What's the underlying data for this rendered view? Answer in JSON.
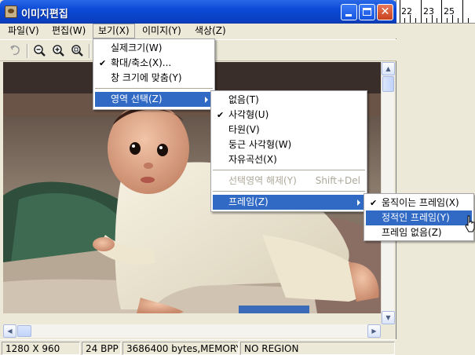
{
  "window": {
    "title": "이미지편집",
    "minimize_icon": "minimize-icon",
    "maximize_icon": "maximize-icon",
    "close_icon": "close-icon"
  },
  "menubar": [
    {
      "label": "파일(V)"
    },
    {
      "label": "편집(W)"
    },
    {
      "label": "보기(X)"
    },
    {
      "label": "이미지(Y)"
    },
    {
      "label": "색상(Z)"
    }
  ],
  "toolbar": {
    "icons": [
      "undo-icon",
      "zoom-out-icon",
      "zoom-in-icon",
      "zoom-fit-icon"
    ]
  },
  "view_menu": {
    "items": [
      {
        "label": "실제크기(W)",
        "checked": false
      },
      {
        "label": "확대/축소(X)...",
        "checked": true
      },
      {
        "label": "창 크기에 맞춤(Y)",
        "checked": false
      },
      {
        "label": "영역 선택(Z)",
        "submenu": true,
        "highlighted": true
      }
    ]
  },
  "region_menu": {
    "items": [
      {
        "label": "없음(T)",
        "checked": false
      },
      {
        "label": "사각형(U)",
        "checked": true
      },
      {
        "label": "타원(V)",
        "checked": false
      },
      {
        "label": "둥근 사각형(W)",
        "checked": false
      },
      {
        "label": "자유곡선(X)",
        "checked": false
      },
      {
        "label": "선택영역 해제(Y)",
        "shortcut": "Shift+Del",
        "disabled": true
      },
      {
        "label": "프레임(Z)",
        "submenu": true,
        "highlighted": true
      }
    ]
  },
  "frame_menu": {
    "items": [
      {
        "label": "움직이는 프레임(X)",
        "checked": true
      },
      {
        "label": "정적인 프레임(Y)",
        "checked": false,
        "highlighted": true
      },
      {
        "label": "프레임 없음(Z)",
        "checked": false
      }
    ]
  },
  "statusbar": {
    "dimensions": "1280 X 960",
    "bpp": "24 BPP",
    "memory": "3686400 bytes,MEMORY",
    "region": "NO REGION"
  },
  "ruler": {
    "labels": [
      "22",
      "23",
      "25"
    ]
  },
  "colors": {
    "title_blue": "#0c4ad6",
    "highlight": "#316ac5",
    "close_red": "#c8401e"
  }
}
